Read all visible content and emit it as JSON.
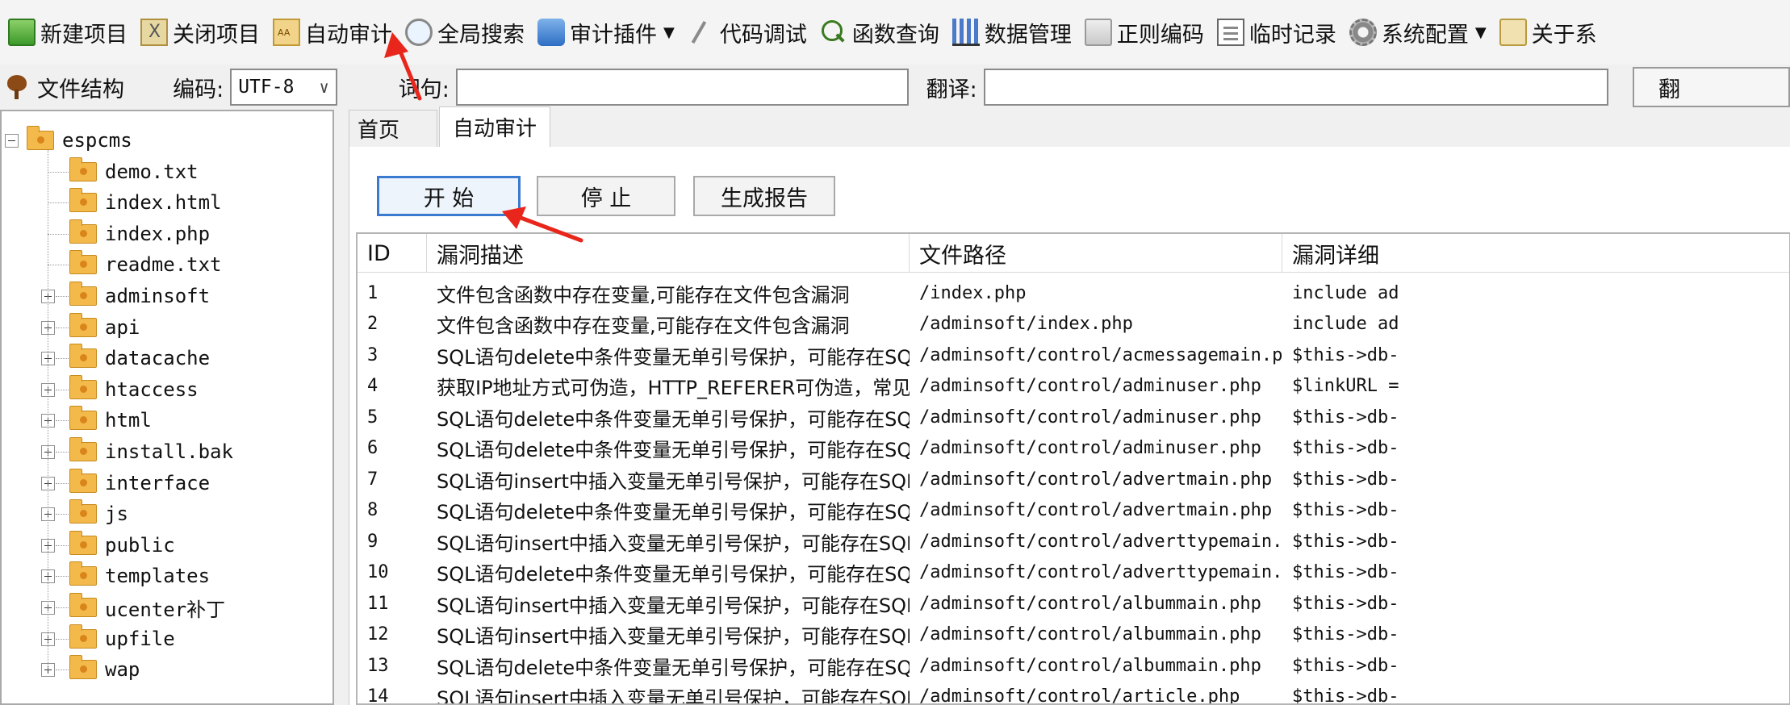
{
  "toolbar": {
    "items": [
      {
        "label": "新建项目",
        "icon": "new-project-icon"
      },
      {
        "label": "关闭项目",
        "icon": "close-project-icon"
      },
      {
        "label": "自动审计",
        "icon": "auto-audit-icon"
      },
      {
        "label": "全局搜索",
        "icon": "search-icon"
      },
      {
        "label": "审计插件",
        "icon": "plugin-icon",
        "dropdown": true
      },
      {
        "label": "代码调试",
        "icon": "debug-icon"
      },
      {
        "label": "函数查询",
        "icon": "function-search-icon"
      },
      {
        "label": "数据管理",
        "icon": "data-icon"
      },
      {
        "label": "正则编码",
        "icon": "regex-icon"
      },
      {
        "label": "临时记录",
        "icon": "note-icon"
      },
      {
        "label": "系统配置",
        "icon": "gear-icon",
        "dropdown": true
      },
      {
        "label": "关于系",
        "icon": "about-icon"
      }
    ]
  },
  "controls": {
    "file_structure_label": "文件结构",
    "encoding_label": "编码:",
    "encoding_value": "UTF-8",
    "word_label": "词句:",
    "word_value": "",
    "translate_label": "翻译:",
    "translate_value": "",
    "translate_button": "翻"
  },
  "tree": {
    "root": "espcms",
    "files": [
      "demo.txt",
      "index.html",
      "index.php",
      "readme.txt"
    ],
    "folders": [
      "adminsoft",
      "api",
      "datacache",
      "htaccess",
      "html",
      "install.bak",
      "interface",
      "js",
      "public",
      "templates",
      "ucenter补丁",
      "upfile",
      "wap"
    ]
  },
  "tabs": {
    "home": "首页",
    "active": "自动审计"
  },
  "buttons": {
    "start": "开 始",
    "stop": "停 止",
    "report": "生成报告"
  },
  "table": {
    "headers": [
      "ID",
      "漏洞描述",
      "文件路径",
      "漏洞详细"
    ],
    "rows": [
      [
        "1",
        "文件包含函数中存在变量,可能存在文件包含漏洞",
        "/index.php",
        "include ad"
      ],
      [
        "2",
        "文件包含函数中存在变量,可能存在文件包含漏洞",
        "/adminsoft/index.php",
        "include ad"
      ],
      [
        "3",
        "SQL语句delete中条件变量无单引号保护，可能存在SQL注入漏洞",
        "/adminsoft/control/acmessagemain.php",
        "$this->db-"
      ],
      [
        "4",
        "获取IP地址方式可伪造，HTTP_REFERER可伪造，常见引发SQL...",
        "/adminsoft/control/adminuser.php",
        "$linkURL ="
      ],
      [
        "5",
        "SQL语句delete中条件变量无单引号保护，可能存在SQL注入漏洞",
        "/adminsoft/control/adminuser.php",
        "$this->db-"
      ],
      [
        "6",
        "SQL语句delete中条件变量无单引号保护，可能存在SQL注入漏洞",
        "/adminsoft/control/adminuser.php",
        "$this->db-"
      ],
      [
        "7",
        "SQL语句insert中插入变量无单引号保护，可能存在SQL注入漏洞",
        "/adminsoft/control/advertmain.php",
        "$this->db-"
      ],
      [
        "8",
        "SQL语句delete中条件变量无单引号保护，可能存在SQL注入漏洞",
        "/adminsoft/control/advertmain.php",
        "$this->db-"
      ],
      [
        "9",
        "SQL语句insert中插入变量无单引号保护，可能存在SQL注入漏洞",
        "/adminsoft/control/adverttypemain.php",
        "$this->db-"
      ],
      [
        "10",
        "SQL语句delete中条件变量无单引号保护，可能存在SQL注入漏洞",
        "/adminsoft/control/adverttypemain.php",
        "$this->db-"
      ],
      [
        "11",
        "SQL语句insert中插入变量无单引号保护，可能存在SQL注入漏洞",
        "/adminsoft/control/albummain.php",
        "$this->db-"
      ],
      [
        "12",
        "SQL语句insert中插入变量无单引号保护，可能存在SQL注入漏洞",
        "/adminsoft/control/albummain.php",
        "$this->db-"
      ],
      [
        "13",
        "SQL语句delete中条件变量无单引号保护，可能存在SQL注入漏洞",
        "/adminsoft/control/albummain.php",
        "$this->db-"
      ],
      [
        "14",
        "SQL语句insert中插入变量无单引号保护，可能存在SQL注入漏洞",
        "/adminsoft/control/article.php",
        "$this->db-"
      ]
    ]
  },
  "colors": {
    "annotation_arrow": "#e8261c",
    "start_button_border": "#3a7ad0"
  }
}
